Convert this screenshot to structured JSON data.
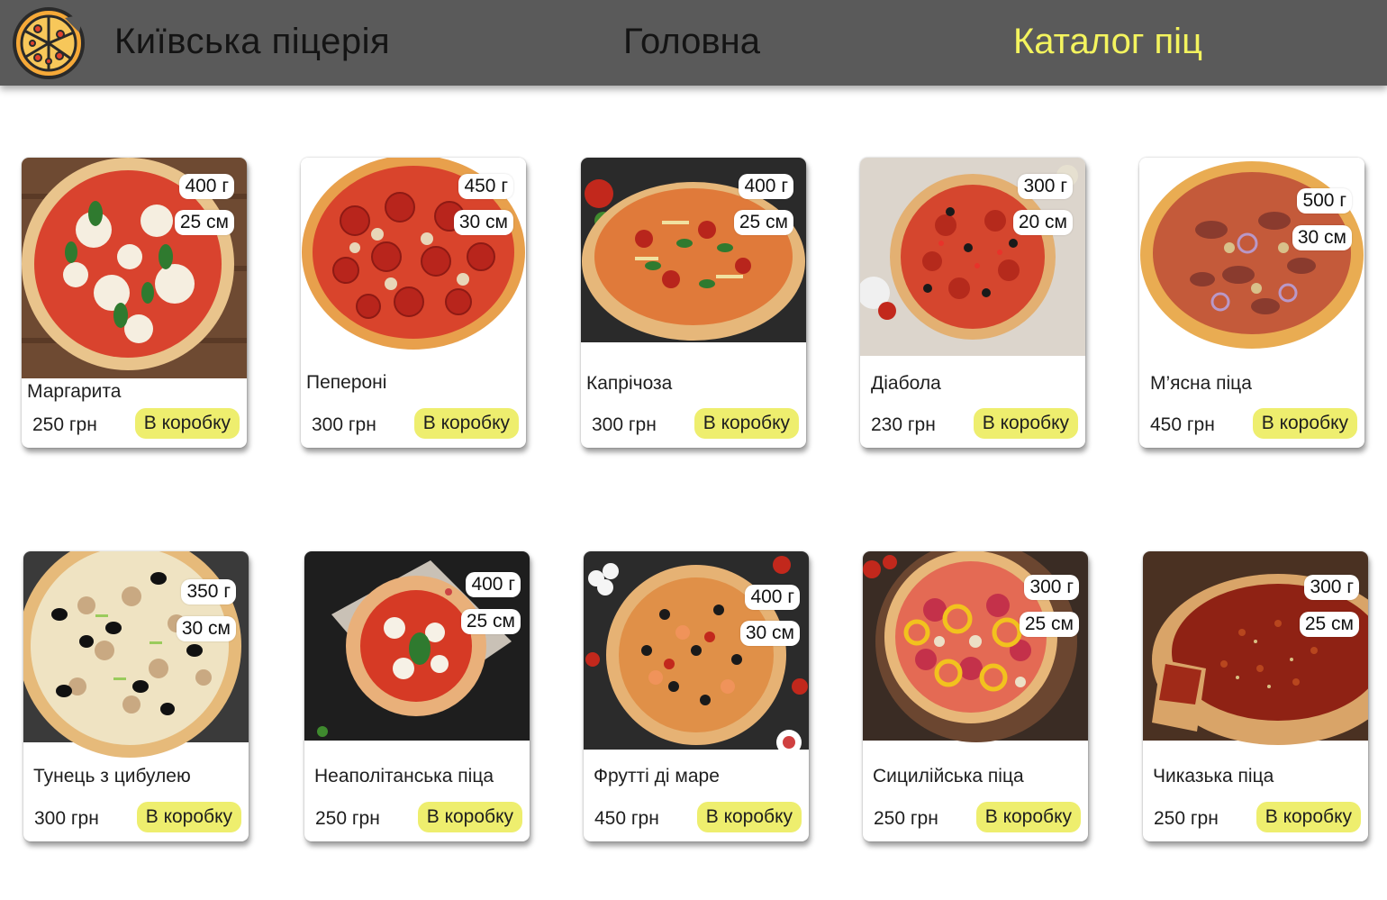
{
  "header": {
    "brand": "Київська піцерія",
    "logo_icon": "pizza-icon",
    "nav": {
      "home": "Головна",
      "catalog": "Каталог піц"
    },
    "colors": {
      "bar": "#5a5a5a",
      "active_nav": "#f4f45e"
    }
  },
  "cart_button_color": "#eeee6e",
  "products": [
    {
      "name": "Маргарита",
      "price": "250 грн",
      "weight": "400 г",
      "diameter": "25 см",
      "button": "В коробку"
    },
    {
      "name": "Пепероні",
      "price": "300 грн",
      "weight": "450 г",
      "diameter": "30 см",
      "button": "В коробку"
    },
    {
      "name": "Капрічоза",
      "price": "300 грн",
      "weight": "400 г",
      "diameter": "25 см",
      "button": "В коробку"
    },
    {
      "name": "Діабола",
      "price": "230 грн",
      "weight": "300 г",
      "diameter": "20 см",
      "button": "В коробку"
    },
    {
      "name": "М’ясна піца",
      "price": "450 грн",
      "weight": "500 г",
      "diameter": "30 см",
      "button": "В коробку"
    },
    {
      "name": "Тунець з цибулею",
      "price": "300 грн",
      "weight": "350 г",
      "diameter": "30 см",
      "button": "В коробку"
    },
    {
      "name": "Неаполітанська піца",
      "price": "250 грн",
      "weight": "400 г",
      "diameter": "25 см",
      "button": "В коробку"
    },
    {
      "name": "Фрутті ді маре",
      "price": "450 грн",
      "weight": "400 г",
      "diameter": "30 см",
      "button": "В коробку"
    },
    {
      "name": "Сицилійська піца",
      "price": "250 грн",
      "weight": "300 г",
      "diameter": "25 см",
      "button": "В коробку"
    },
    {
      "name": "Чиказька піца",
      "price": "250 грн",
      "weight": "300 г",
      "diameter": "25 см",
      "button": "В коробку"
    }
  ]
}
